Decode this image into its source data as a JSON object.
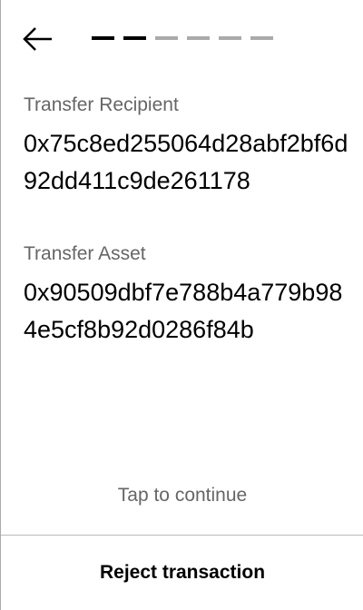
{
  "header": {
    "back_icon": "arrow-left-icon",
    "progress": {
      "current_step": 2,
      "total_steps": 6
    }
  },
  "fields": [
    {
      "label": "Transfer Recipient",
      "value": "0x75c8ed255064d28abf2bf6d92dd411c9de261178"
    },
    {
      "label": "Transfer Asset",
      "value": "0x90509dbf7e788b4a779b984e5cf8b92d0286f84b"
    }
  ],
  "footer": {
    "tap_hint": "Tap to continue",
    "reject_label": "Reject transaction"
  }
}
